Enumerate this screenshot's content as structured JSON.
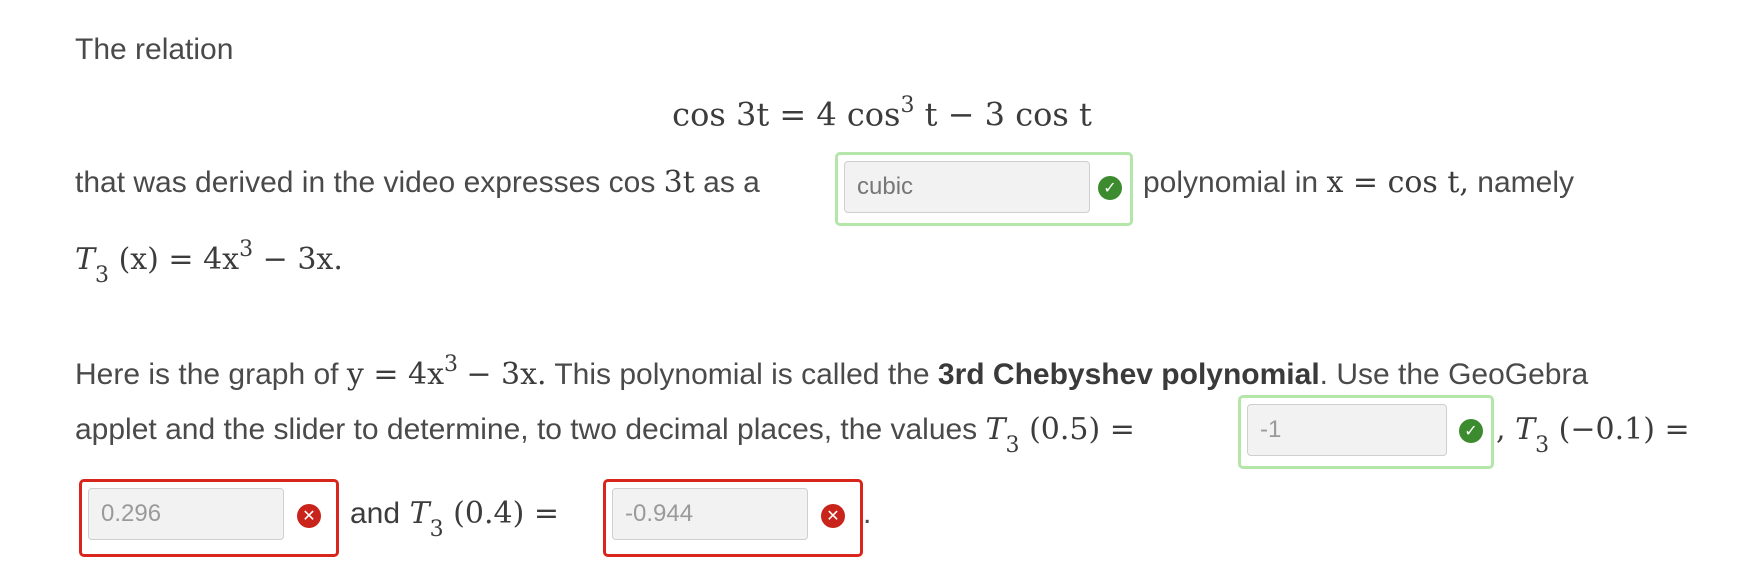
{
  "intro": "The relation",
  "equation": {
    "lhs": "cos 3t",
    "eq": "=",
    "rhs_a": "4 cos",
    "rhs_exp": "3",
    "rhs_b": "t − 3 cos t"
  },
  "line2": {
    "before": "that was derived in the video expresses cos",
    "math_3t": "3t",
    "as_a": "as a",
    "after": "polynomial in",
    "xeq": "x = cos t,",
    "namely": "namely"
  },
  "line3": {
    "T": "T",
    "sub": "3",
    "rest": "(x) = 4x",
    "exp": "3",
    "tail": "− 3x."
  },
  "line4": {
    "before": "Here is the graph of",
    "eq_a": "y = 4x",
    "eq_exp": "3",
    "eq_b": "− 3x.",
    "mid": "This polynomial is called the",
    "bold": "3rd Chebyshev polynomial",
    "after": ". Use the GeoGebra"
  },
  "line5": {
    "text": "applet and the slider to determine, to two decimal places, the values",
    "t1_T": "T",
    "t1_sub": "3",
    "t1_arg": "(0.5) =",
    "comma": ",",
    "t2_T": "T",
    "t2_sub": "3",
    "t2_arg": "(−0.1) ="
  },
  "line6": {
    "and": "and",
    "t3_T": "T",
    "t3_sub": "3",
    "t3_arg": "(0.4) =",
    "period": "."
  },
  "answers": {
    "cubic": {
      "value": "cubic",
      "status": "correct"
    },
    "t3_05": {
      "value": "-1",
      "status": "correct"
    },
    "t3_m01": {
      "value": "0.296",
      "status": "incorrect"
    },
    "t3_04": {
      "value": "-0.944",
      "status": "incorrect"
    }
  },
  "icons": {
    "correct": "check-circle-icon",
    "incorrect": "x-circle-icon"
  },
  "colors": {
    "correct_border": "#b3e6a8",
    "incorrect_border": "#d9261c",
    "correct_icon": "#3d8b2f",
    "incorrect_icon": "#c9241b"
  }
}
